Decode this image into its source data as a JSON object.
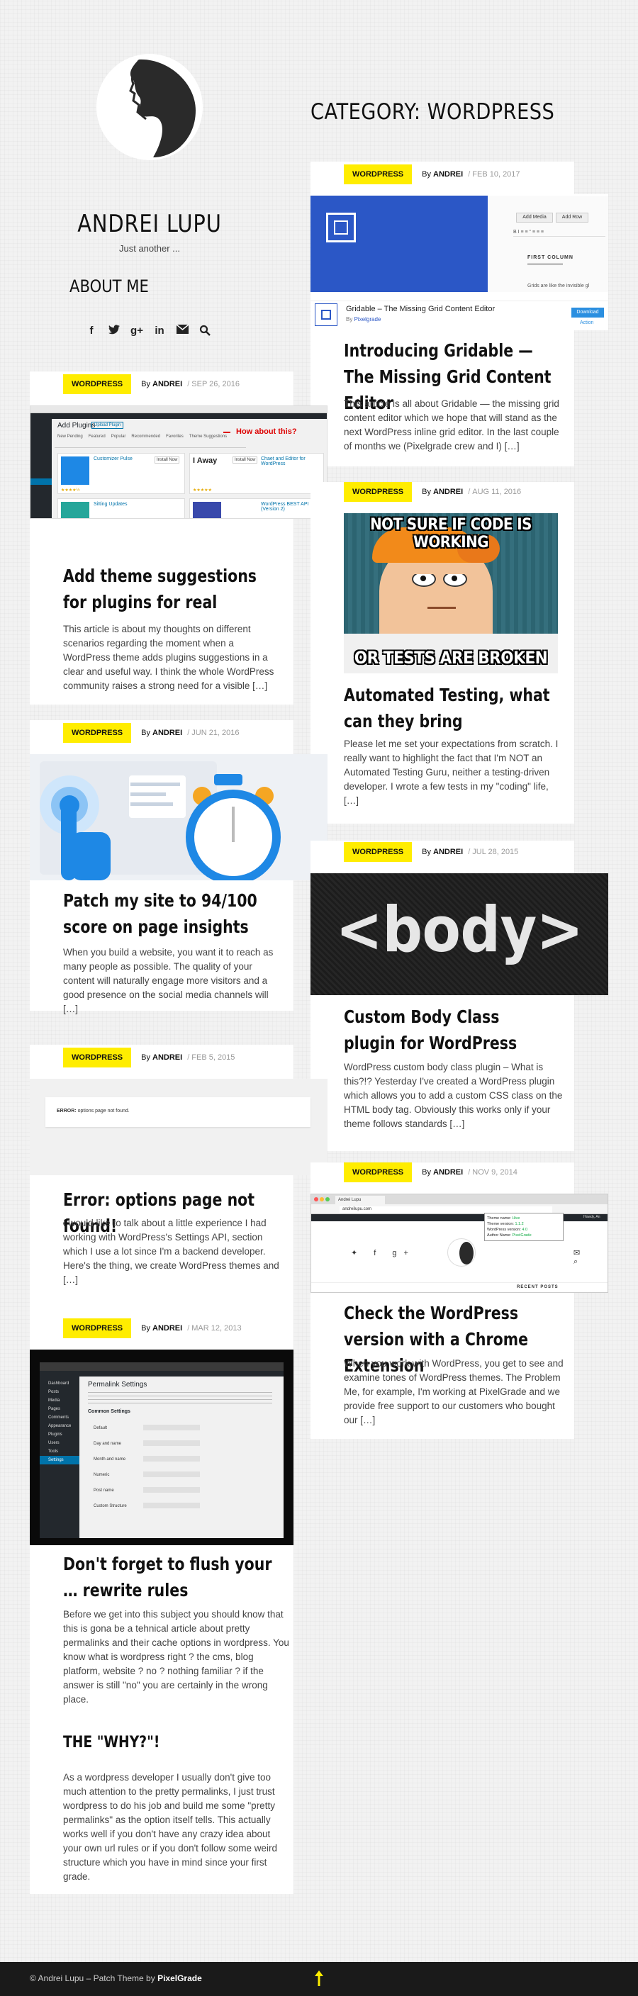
{
  "site": {
    "title": "ANDREI LUPU",
    "tagline": "Just another ...",
    "about": "ABOUT ME"
  },
  "social": [
    "facebook-icon",
    "twitter-icon",
    "googleplus-icon",
    "linkedin-icon",
    "email-icon",
    "search-icon"
  ],
  "category_title": "CATEGORY: WORDPRESS",
  "posts": [
    {
      "category": "WORDPRESS",
      "by": "By",
      "author": "ANDREI",
      "date": "FEB 10, 2017",
      "title": "Introducing Gridable — The Missing Grid Content Editor",
      "excerpt": "This article is all about Gridable — the missing grid content editor which we hope that will stand as the next WordPress inline grid editor. In the last couple of months we (Pixelgrade crew and I) […]",
      "figure": {
        "add_media": "Add Media",
        "add_row": "Add Row",
        "first_column": "FIRST COLUMN",
        "grid_note": "Grids are like the invisible gl",
        "plugin_name": "Gridable – The Missing Grid Content Editor",
        "plugin_by": "By",
        "plugin_author": "Pixelgrade",
        "download": "Download",
        "action": "Action"
      }
    },
    {
      "category": "WORDPRESS",
      "by": "By",
      "author": "ANDREI",
      "date": "SEP 26, 2016",
      "title": "Add theme suggestions for plugins for real",
      "excerpt": "This article is about my thoughts on different scenarios regarding the moment when a WordPress theme adds plugins suggestions in a clear and useful way. I think the whole WordPress community raises a strong need for a visible […]",
      "figure": {
        "heading": "Add Plugins",
        "upload": "Upload Plugin",
        "how": "How about this?",
        "tabs": [
          "New Pending",
          "Featured",
          "Popular",
          "Recommended",
          "Favorites",
          "Theme Suggestions"
        ],
        "plugin1": "Customizer Pulse",
        "plugin2": "I Away",
        "plugin3": "Sitting Updates",
        "plugin4": "Chaet and Editor for WordPress",
        "plugin5": "WordPress BEST API (Version 2)",
        "install": "Install Now"
      }
    },
    {
      "category": "WORDPRESS",
      "by": "By",
      "author": "ANDREI",
      "date": "AUG 11, 2016",
      "title": "Automated Testing, what can they bring",
      "excerpt": "Please let me set your expectations from scratch. I really want to highlight the fact that I'm NOT an Automated Testing Guru, neither a testing-driven developer. I wrote a few tests in my \"coding\" life, […]",
      "figure": {
        "top": "NOT SURE IF CODE IS WORKING",
        "bottom": "OR TESTS ARE BROKEN"
      }
    },
    {
      "category": "WORDPRESS",
      "by": "By",
      "author": "ANDREI",
      "date": "JUN 21, 2016",
      "title": "Patch my site to 94/100 score on page insights",
      "excerpt": "When you build a website, you want it to reach as many people as possible. The quality of your content will naturally engage more visitors and a good presence on the social media channels will […]"
    },
    {
      "category": "WORDPRESS",
      "by": "By",
      "author": "ANDREI",
      "date": "JUL 28, 2015",
      "title": "Custom Body Class plugin for WordPress",
      "excerpt": "WordPress custom body class plugin – What is this?!? Yesterday I've created a WordPress plugin which allows you to add a custom CSS class on the HTML body tag. Obviously this works only if your theme follows standards […]",
      "figure": {
        "code": "<body>"
      }
    },
    {
      "category": "WORDPRESS",
      "by": "By",
      "author": "ANDREI",
      "date": "FEB 5, 2015",
      "title": "Error: options page not found!",
      "excerpt": "I would like to talk about a little experience I had working with WordPress's Settings API, section which I use a lot since I'm a backend developer. Here's the thing, we create WordPress themes and […]",
      "figure": {
        "error_label": "ERROR:",
        "error_msg": "options page not found."
      }
    },
    {
      "category": "WORDPRESS",
      "by": "By",
      "author": "ANDREI",
      "date": "NOV 9, 2014",
      "title": "Check the WordPress version with a Chrome Extension",
      "excerpt": "When you work with WordPress, you get to see and examine tones of WordPress themes. The Problem Me, for example, I'm working at PixelGrade and we provide free support to our customers who bought our […]",
      "figure": {
        "tab": "Andrei Lupu",
        "url": "andreilupu.com",
        "theme_name": "Theme name:",
        "theme_name_v": "Hive",
        "theme_version": "Theme version:",
        "theme_version_v": "1.1.2",
        "wp_version": "WordPress version:",
        "wp_version_v": "4.0",
        "author_name": "Author Name:",
        "author_name_v": "PixelGrade",
        "recent": "RECENT POSTS",
        "howdy": "Howdy, An"
      }
    },
    {
      "category": "WORDPRESS",
      "by": "By",
      "author": "ANDREI",
      "date": "MAR 12, 2013",
      "title": "Don't forget to flush your … rewrite rules",
      "excerpt": "Before we get into this subject you should know that this is gona be a tehnical article about pretty permalinks and their cache options in wordpress. You know what is wordpress right ? the cms, blog platform, website ? no ? nothing familiar ? if the answer is still \"no\" you are certainly in the wrong place.",
      "heading2": "THE \"WHY?\"!",
      "excerpt2": "As a wordpress developer I usually don't give too much attention to the pretty permalinks, I just trust wordpress to do his job and build me some \"pretty permalinks\" as the option itself tells. This actually works well if you don't have any crazy idea about your own url rules or if you don't follow some weird structure which you have in mind since your first grade.",
      "figure": {
        "heading": "Permalink Settings",
        "common": "Common Settings",
        "rows": [
          "Default",
          "Day and name",
          "Month and name",
          "Numeric",
          "Post name",
          "Custom Structure"
        ],
        "menu": [
          "Dashboard",
          "Posts",
          "Media",
          "Pages",
          "Comments",
          "Appearance",
          "Plugins",
          "Users",
          "Tools",
          "Settings"
        ]
      }
    }
  ],
  "footer": {
    "text": "© Andrei Lupu – Patch Theme by",
    "link": "PixelGrade"
  },
  "colors": {
    "badge": "#ffed00",
    "dark": "#111111",
    "blue": "#2b57c6"
  }
}
